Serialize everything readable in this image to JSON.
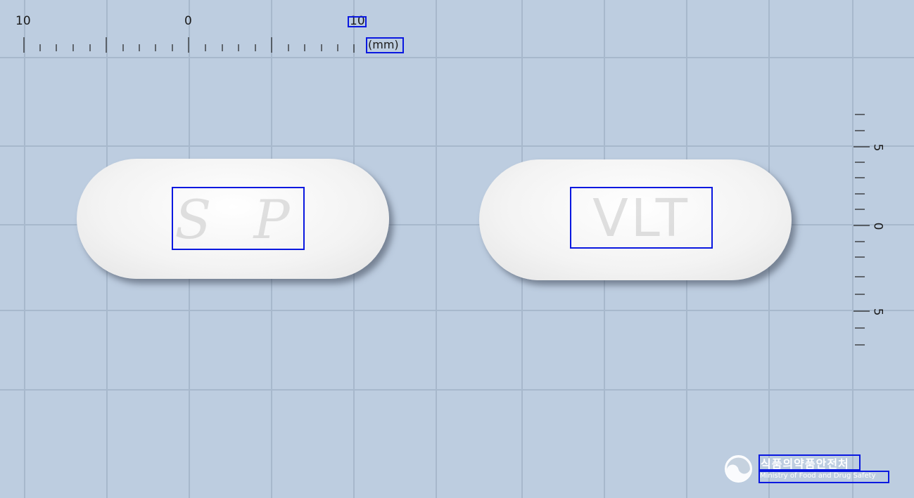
{
  "ruler_top": {
    "labels": [
      "10",
      "0",
      "10"
    ],
    "unit": "(mm)"
  },
  "ruler_right": {
    "labels": [
      "5",
      "0",
      "5"
    ]
  },
  "tablets": [
    {
      "imprint": "S P",
      "color": "#f4f4f4"
    },
    {
      "imprint": "VLT",
      "color": "#f4f4f4"
    }
  ],
  "logo": {
    "name_ko": "식품의약품안전처",
    "name_en": "Ministry of Food and Drug Safety"
  },
  "colors": {
    "background": "#bdcde0",
    "grid": "#a6b8cc",
    "highlight": "#0a18e0"
  }
}
